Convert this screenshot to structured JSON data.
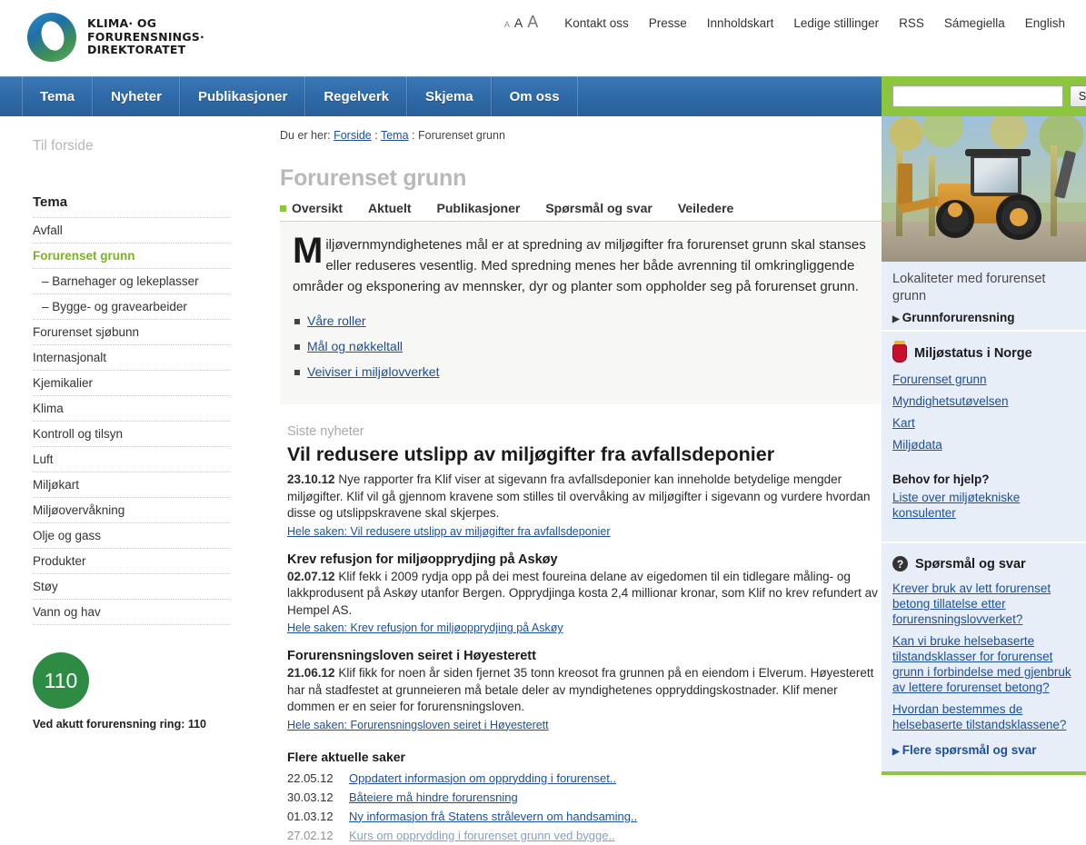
{
  "header": {
    "logo_lines": [
      "KLIMA· OG",
      "FORURENSNINGS·",
      "DIREKTORATET"
    ],
    "font_sizes": [
      "A",
      "A",
      "A"
    ],
    "top_links": [
      "Kontakt oss",
      "Presse",
      "Innholdskart",
      "Ledige stillinger",
      "RSS",
      "Sámegiella",
      "English"
    ]
  },
  "nav": {
    "items": [
      "Tema",
      "Nyheter",
      "Publikasjoner",
      "Regelverk",
      "Skjema",
      "Om oss"
    ],
    "search_value": "",
    "search_placeholder": "",
    "search_button": "Søk",
    "bar_color": "#2f6aa8",
    "search_zone_color": "#8cc63f"
  },
  "sidebar": {
    "home_link": "Til forside",
    "title": "Tema",
    "items": [
      {
        "label": "Avfall",
        "active": false,
        "sub": false
      },
      {
        "label": "Forurenset grunn",
        "active": true,
        "sub": false
      },
      {
        "label": "– Barnehager og lekeplasser",
        "active": false,
        "sub": true
      },
      {
        "label": "– Bygge- og gravearbeider",
        "active": false,
        "sub": true
      },
      {
        "label": "Forurenset sjøbunn",
        "active": false,
        "sub": false
      },
      {
        "label": "Internasjonalt",
        "active": false,
        "sub": false
      },
      {
        "label": "Kjemikalier",
        "active": false,
        "sub": false
      },
      {
        "label": "Klima",
        "active": false,
        "sub": false
      },
      {
        "label": "Kontroll og tilsyn",
        "active": false,
        "sub": false
      },
      {
        "label": "Luft",
        "active": false,
        "sub": false
      },
      {
        "label": "Miljøkart",
        "active": false,
        "sub": false
      },
      {
        "label": "Miljøovervåkning",
        "active": false,
        "sub": false
      },
      {
        "label": "Olje og gass",
        "active": false,
        "sub": false
      },
      {
        "label": "Produkter",
        "active": false,
        "sub": false
      },
      {
        "label": "Støy",
        "active": false,
        "sub": false
      },
      {
        "label": "Vann og hav",
        "active": false,
        "sub": false
      }
    ],
    "emergency": {
      "number": "110",
      "caption": "Ved akutt forurensning ring: 110",
      "color": "#2e8b43"
    }
  },
  "main": {
    "breadcrumb_prefix": "Du er her:",
    "breadcrumb": [
      "Forside",
      "Tema",
      "Forurenset grunn"
    ],
    "page_title": "Forurenset grunn",
    "tabs": [
      {
        "label": "Oversikt",
        "active": true
      },
      {
        "label": "Aktuelt",
        "active": false
      },
      {
        "label": "Publikasjoner",
        "active": false
      },
      {
        "label": "Spørsmål og svar",
        "active": false
      },
      {
        "label": "Veiledere",
        "active": false
      }
    ],
    "lead_dropcap": "M",
    "lead_text": "iljøvernmyndighetenes mål er at spredning av miljøgifter fra forurenset grunn skal stanses eller reduseres vesentlig. Med spredning menes her både avrenning til omkringliggende områder og eksponering av mennsker, dyr og planter som oppholder seg på forurenset grunn.",
    "bullet_links": [
      "Våre roller",
      "Mål og nøkkeltall",
      "Veiviser i miljølovverket"
    ],
    "news_label": "Siste nyheter",
    "news": [
      {
        "title": "Vil redusere utslipp av miljøgifter fra avfallsdeponier",
        "date": "23.10.12",
        "body": "Nye rapporter fra Klif viser at sigevann fra avfallsdeponier kan inneholde betydelige mengder miljøgifter. Klif vil gå gjennom kravene som stilles til overvåking av miljøgifter i sigevann og vurdere hvordan disse og utslippskravene skal skjerpes.",
        "more": "Hele saken: Vil redusere utslipp av miljøgifter fra avfallsdeponier"
      },
      {
        "title": "Krev refusjon for miljøopprydjing på Askøy",
        "date": "02.07.12",
        "body": "Klif fekk i 2009 rydja opp på dei mest foureina delane av eigedomen til ein tidlegare måling- og lakkprodusent på Askøy utanfor Bergen. Opprydjinga kosta 2,4 millionar kronar, som Klif no krev refundert av Hempel AS.",
        "more": "Hele saken: Krev refusjon for miljøopprydjing på Askøy"
      },
      {
        "title": "Forurensningsloven seiret i Høyesterett",
        "date": "21.06.12",
        "body": "Klif fikk for noen år siden fjernet 35 tonn kreosot fra grunnen på en eiendom i Elverum. Høyesterett har nå stadfestet at grunneieren må betale deler av myndighetenes oppryddingskostnader. Klif mener dommen er en seier for forurensningsloven.",
        "more": "Hele saken: Forurensningsloven seiret i Høyesterett"
      }
    ],
    "more_heading": "Flere aktuelle saker",
    "more_items": [
      {
        "date": "22.05.12",
        "title": "Oppdatert informasjon om opprydding i forurenset.."
      },
      {
        "date": "30.03.12",
        "title": "Båteiere må hindre forurensning"
      },
      {
        "date": "01.03.12",
        "title": "Ny informasjon frå Statens strålevern om handsaming.."
      },
      {
        "date": "27.02.12",
        "title": "Kurs om opprydding i forurenset grunn ved bygge.."
      }
    ]
  },
  "aside": {
    "promo": {
      "caption": "Lokaliteter med forurenset grunn",
      "link": "Grunnforurensning"
    },
    "miljostatus": {
      "heading": "Miljøstatus i Norge",
      "links": [
        "Forurenset grunn",
        "Myndighetsutøvelsen",
        "Kart",
        "Miljødata"
      ],
      "help_heading": "Behov for hjelp?",
      "help_link": "Liste over miljøtekniske konsulenter"
    },
    "faq": {
      "heading": "Spørsmål og svar",
      "links": [
        "Krever bruk av lett forurenset betong tillatelse etter forurensningslovverket?",
        "Kan vi bruke helsebaserte tilstandsklasser for forurenset grunn i forbindelse med gjenbruk av lettere forurenset betong?",
        "Hvordan bestemmes de helsebaserte tilstandsklassene?"
      ],
      "more": "Flere spørsmål og svar"
    }
  }
}
